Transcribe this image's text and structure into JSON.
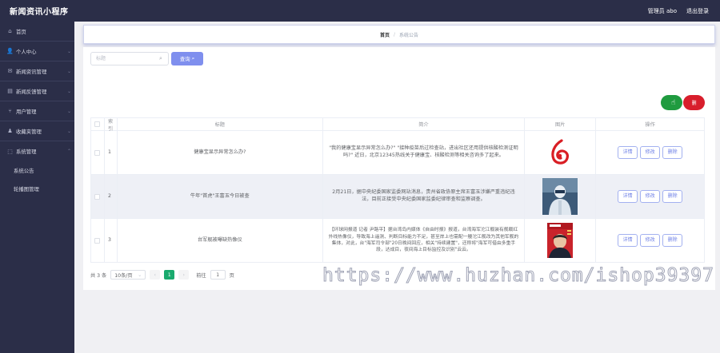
{
  "app": {
    "title": "新闻资讯小程序"
  },
  "topbar": {
    "user_label": "管理员 abo",
    "logout_label": "退出登录"
  },
  "sidebar": {
    "items": [
      {
        "label": "首页",
        "icon": "home-icon",
        "glyph": "⌂",
        "chevron": false
      },
      {
        "label": "个人中心",
        "icon": "user-icon",
        "glyph": "👤",
        "chevron": true
      },
      {
        "label": "新闻资讯管理",
        "icon": "mail-icon",
        "glyph": "✉",
        "chevron": true
      },
      {
        "label": "新闻反馈管理",
        "icon": "note-icon",
        "glyph": "▤",
        "chevron": true
      },
      {
        "label": "用户管理",
        "icon": "route-icon",
        "glyph": "⑂",
        "chevron": true
      },
      {
        "label": "收藏夹管理",
        "icon": "person-icon",
        "glyph": "♟",
        "chevron": true
      },
      {
        "label": "系统管理",
        "icon": "dashed-square-icon",
        "glyph": "⬚",
        "chevron": true
      }
    ],
    "subitems": [
      {
        "label": "系统公告"
      },
      {
        "label": "轮播图管理"
      }
    ]
  },
  "breadcrumb": {
    "home": "首页",
    "separator": "/",
    "current": "系统公告"
  },
  "search": {
    "placeholder": "标题",
    "value": "",
    "button_label": "查询"
  },
  "actions": {
    "add_label": "新增",
    "delete_label": "删除"
  },
  "table": {
    "headers": {
      "index": "索引",
      "title": "标题",
      "intro": "简介",
      "image": "图片",
      "ops": "操作"
    },
    "op_labels": {
      "detail": "详情",
      "edit": "修改",
      "delete": "删除"
    },
    "rows": [
      {
        "index": "1",
        "title": "健康宝显示异常怎么办?",
        "intro": "\"我的健康宝显示异常怎么办?\" \"接种疫苗后过检查站，进出社区还用提供核酸检测证明吗?\" 近日，北京12345热线关于健康宝、核酸检测等相关咨询多了起来。",
        "image": "red-logo"
      },
      {
        "index": "2",
        "title": "牛年\"首虎\"王富玉今日被查",
        "intro": "2月21日，据中央纪委国家监委网站消息，贵州省政协原主席王富玉涉嫌严重违纪违法，目前正接受中央纪委国家监委纪律审查和监察调查。",
        "image": "protective-suit-photo"
      },
      {
        "index": "3",
        "title": "台军舰被曝缺热像仪",
        "intro": "【环球网报道 记者 尹路平】据台湾岛内媒体《自由时报》报道，台湾海军沱江舰装有舰载红外线热像仪，导致海上遥测、判断目标能力不足，甚至岸上也需配一艘沱江舰改为其他军舰的集体，对此，台\"海军司令部\"20日晚间回应，相关\"持续建置\"，还称将\"海军可借由多重手段，达成目，夜间海上目标监控及识别\"云云。",
        "image": "magazine-cover"
      }
    ]
  },
  "pagination": {
    "total_text": "共 3 条",
    "page_size": "10条/页",
    "current_page": "1",
    "jump_prefix": "前往",
    "jump_value": "1",
    "jump_suffix": "页"
  },
  "watermark": "https://www.huzhan.com/ishop39397",
  "colors": {
    "sidebar_bg": "#2b2e48",
    "query_button": "#7f8fee",
    "add_button": "#1f9b3f",
    "delete_button": "#d81e2c",
    "page_active": "#1aaa6e",
    "op_button_text": "#6d7fe6"
  }
}
